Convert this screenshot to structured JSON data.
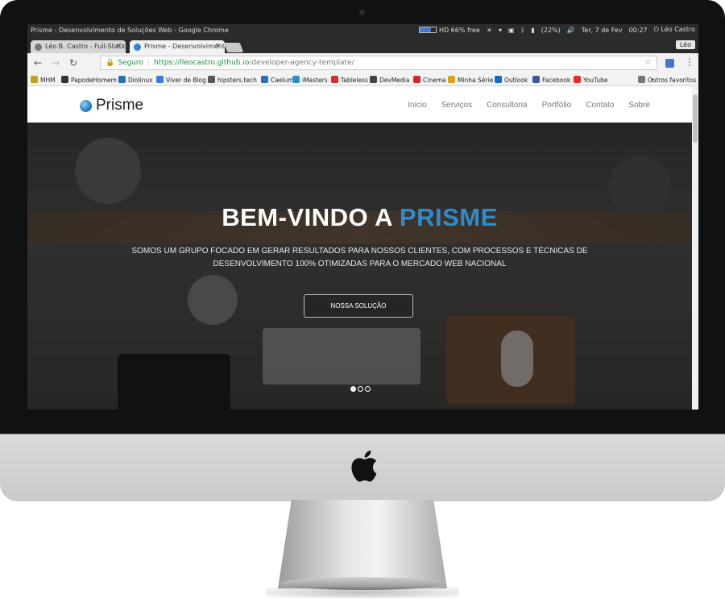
{
  "os": {
    "window_title": "Prisme - Desenvolvimento de Soluções Web - Google Chrome",
    "battery": {
      "label": "HD 66% free",
      "level": 0.66
    },
    "volume": "(22%)",
    "datetime": "Ter, 7 de Fev",
    "time": "00:27",
    "user": "Léo Castro"
  },
  "browser": {
    "tabs": [
      {
        "title": "Léo B. Castro - Full-Stack",
        "active": false,
        "close": "×"
      },
      {
        "title": "Prisme - Desenvolvimento",
        "active": true,
        "close": "×"
      }
    ],
    "profile": "Léo",
    "secure_label": "Seguro",
    "url_host": "https://lleocastro.github.io",
    "url_path": "/developer-agency-template/",
    "bookmarks": [
      {
        "label": "MHM",
        "color": "#c8a020"
      },
      {
        "label": "PapodeHomem",
        "color": "#333333"
      },
      {
        "label": "Diolinux",
        "color": "#2a6fb5"
      },
      {
        "label": "Viver de Blog",
        "color": "#3b7dd8"
      },
      {
        "label": "hipsters.tech",
        "color": "#555555"
      },
      {
        "label": "Caelum",
        "color": "#2f6fb3"
      },
      {
        "label": "iMasters",
        "color": "#2a8fc2"
      },
      {
        "label": "Tableless",
        "color": "#d2312c"
      },
      {
        "label": "DevMedia",
        "color": "#444444"
      },
      {
        "label": "Cinema",
        "color": "#d22a2a"
      },
      {
        "label": "Minha Série",
        "color": "#d8a21d"
      },
      {
        "label": "Outlook",
        "color": "#0a72c6"
      },
      {
        "label": "Facebook",
        "color": "#3b5998"
      },
      {
        "label": "YouTube",
        "color": "#e52d27"
      }
    ],
    "bookmarks_overflow": "»",
    "other_bookmarks": "Outros favoritos"
  },
  "site": {
    "brand": "Prisme",
    "menu": [
      "Inicio",
      "Serviços",
      "Consultoria",
      "Portfólio",
      "Contato",
      "Sobre"
    ],
    "hero": {
      "title_prefix": "BEM-VINDO A ",
      "title_accent": "PRISME",
      "subtitle": "SOMOS UM GRUPO FOCADO EM GERAR RESULTADOS PARA NOSSOS CLIENTES, COM PROCESSOS E TÉCNICAS DE DESENVOLVIMENTO 100% OTIMIZADAS PARA O MERCADO WEB NACIONAL",
      "button": "NOSSA SOLUÇÃO",
      "slides": 3,
      "active_slide": 1
    }
  },
  "colors": {
    "accent": "#2b8ccf",
    "secure": "#1e8e3e"
  }
}
